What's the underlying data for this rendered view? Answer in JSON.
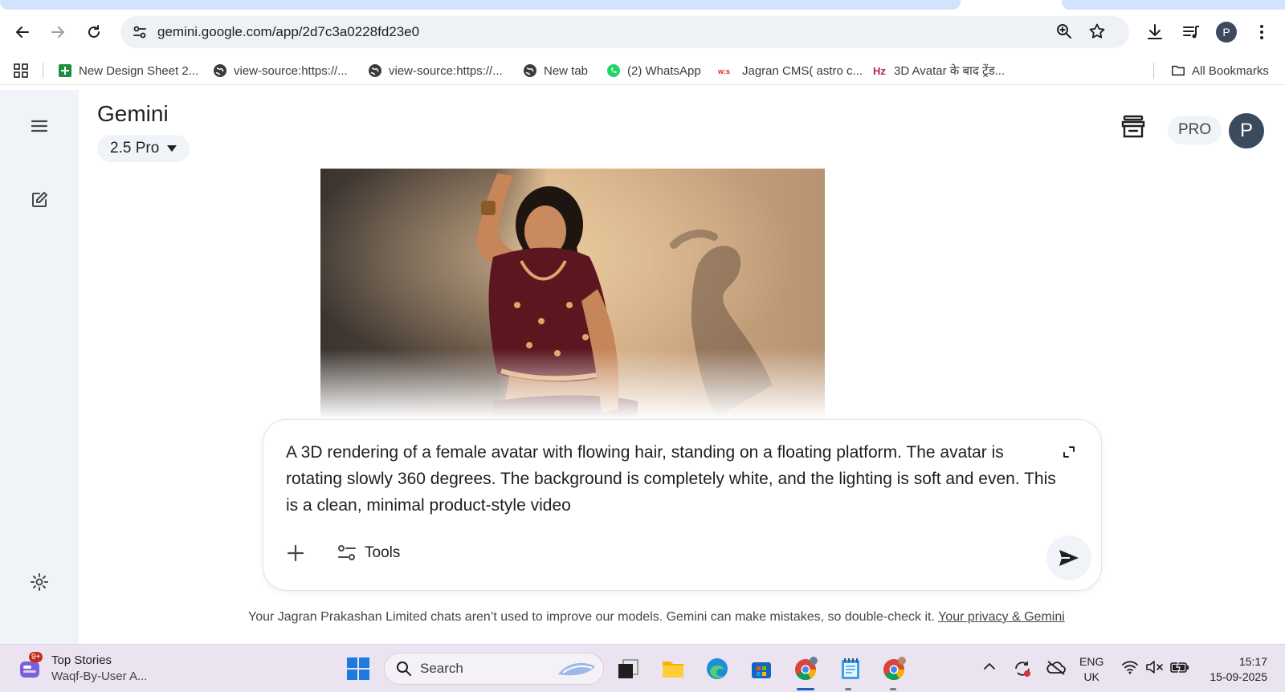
{
  "browser": {
    "url": "gemini.google.com/app/2d7c3a0228fd23e0",
    "profile_initial": "P",
    "bookmarks": [
      {
        "label": "New Design Sheet 2...",
        "icon": "sheets-icon"
      },
      {
        "label": "view-source:https://...",
        "icon": "globe-icon"
      },
      {
        "label": "view-source:https://...",
        "icon": "globe-icon"
      },
      {
        "label": "New tab",
        "icon": "globe-icon"
      },
      {
        "label": "(2) WhatsApp",
        "icon": "whatsapp-icon"
      },
      {
        "label": "Jagran CMS( astro c...",
        "icon": "jagran-icon"
      },
      {
        "label": "3D Avatar के बाद ट्रेंड...",
        "icon": "hz-icon"
      }
    ],
    "all_bookmarks_label": "All Bookmarks"
  },
  "gemini": {
    "title": "Gemini",
    "model_label": "2.5 Pro",
    "pro_badge": "PRO",
    "avatar_initial": "P",
    "prompt_text": "A 3D rendering of a female avatar with flowing hair, standing on a floating platform. The avatar is rotating slowly 360 degrees. The background is completely white, and the lighting is soft and even. This is a clean, minimal product-style video",
    "tools_label": "Tools",
    "disclaimer": "Your Jagran Prakashan Limited chats aren’t used to improve our models. Gemini can make mistakes, so double-check it.",
    "privacy_link": "Your privacy & Gemini"
  },
  "taskbar": {
    "news_title": "Top Stories",
    "news_subtitle": "Waqf-By-User A...",
    "news_badge": "9+",
    "search_label": "Search",
    "lang_line1": "ENG",
    "lang_line2": "UK",
    "time": "15:17",
    "date": "15-09-2025"
  },
  "colors": {
    "sidebar_bg": "#f0f4f9",
    "tab_highlight": "#d3e3fd",
    "taskbar_bg": "#ebe3f0",
    "avatar_bg": "#3b4b5e"
  }
}
